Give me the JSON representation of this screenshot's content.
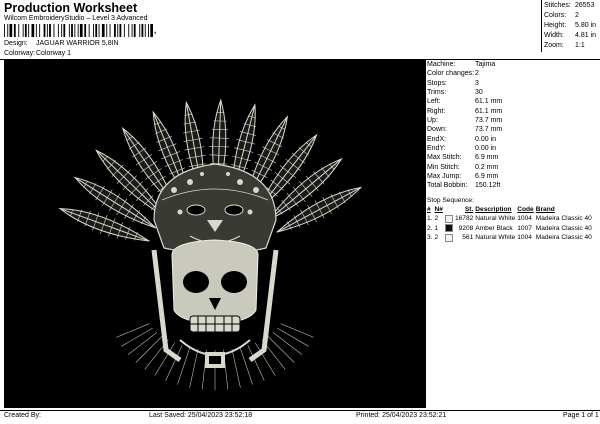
{
  "header": {
    "title": "Production Worksheet",
    "subtitle": "Wilcom EmbroideryStudio – Level 3 Advanced",
    "barcode_mark": ",",
    "design_label": "Design:",
    "design_value": "JAGUAR WARRIOR 5,8IN",
    "colorway_label": "Colorway:",
    "colorway_value": "Colorway 1"
  },
  "stats": [
    {
      "label": "Stitches:",
      "value": "26553"
    },
    {
      "label": "Colors:",
      "value": "2"
    },
    {
      "label": "Height:",
      "value": "5.80 in"
    },
    {
      "label": "Width:",
      "value": "4.81 in"
    },
    {
      "label": "Zoom:",
      "value": "1:1"
    }
  ],
  "specs": [
    {
      "label": "Machine:",
      "value": "Tajima"
    },
    {
      "label": "Color changes:",
      "value": "2"
    },
    {
      "label": "Stops:",
      "value": "3"
    },
    {
      "label": "Trims:",
      "value": "30"
    },
    {
      "label": "Left:",
      "value": "61.1 mm"
    },
    {
      "label": "Right:",
      "value": "61.1 mm"
    },
    {
      "label": "Up:",
      "value": "73.7 mm"
    },
    {
      "label": "Down:",
      "value": "73.7 mm"
    },
    {
      "label": "EndX:",
      "value": "0.00 in"
    },
    {
      "label": "EndY:",
      "value": "0.00 in"
    },
    {
      "label": "Max Stitch:",
      "value": "6.9 mm"
    },
    {
      "label": "Min Stitch:",
      "value": "0.2 mm"
    },
    {
      "label": "Max Jump:",
      "value": "6.9 mm"
    },
    {
      "label": "Total Bobbin:",
      "value": "150.12ft"
    }
  ],
  "stop_sequence": {
    "title": "Stop Sequence:",
    "columns": [
      "#",
      "N#",
      "St.",
      "Description",
      "Code",
      "Brand"
    ],
    "rows": [
      {
        "num": "1.",
        "n": "2",
        "swatch": "#f2f1ea",
        "st": "16782",
        "desc": "Natural White",
        "code": "1004",
        "brand": "Madeira Classic 40"
      },
      {
        "num": "2.",
        "n": "1",
        "swatch": "#111111",
        "st": "9208",
        "desc": "Amber Black",
        "code": "1007",
        "brand": "Madeira Classic 40"
      },
      {
        "num": "3.",
        "n": "2",
        "swatch": "#f2f1ea",
        "st": "561",
        "desc": "Natural White",
        "code": "1004",
        "brand": "Madeira Classic 40"
      }
    ]
  },
  "footer": {
    "created_by": "Created By:",
    "last_saved": "Last Saved: 25/04/2023 23:52:18",
    "printed": "Printed: 25/04/2023 23:52:21",
    "page": "Page 1 of 1"
  },
  "colors": {
    "thread": "#d8d8cc",
    "background": "#000000"
  }
}
